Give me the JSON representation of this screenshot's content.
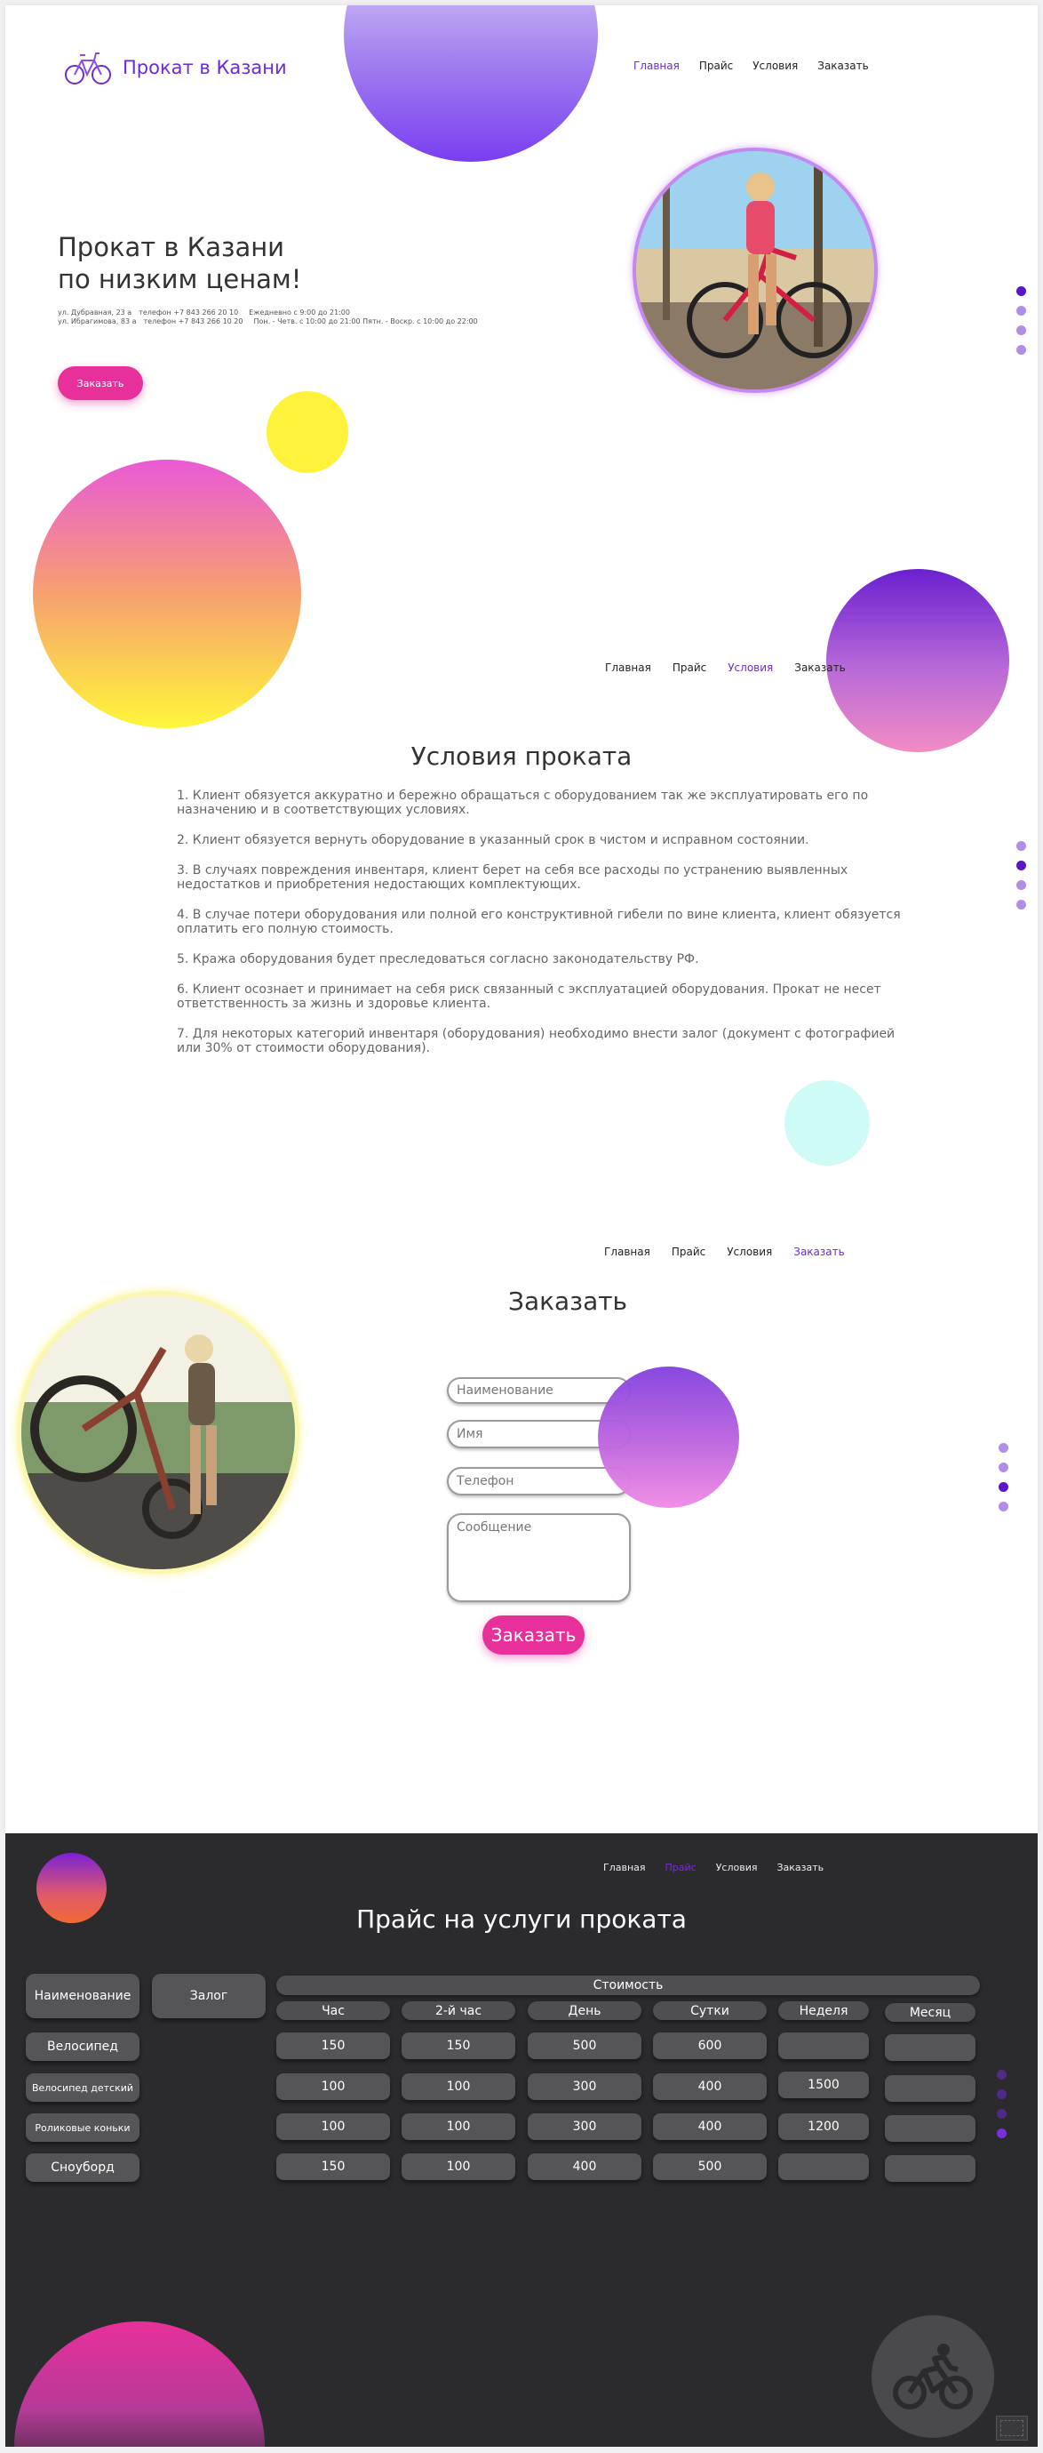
{
  "brand": {
    "name": "Прокат в Казани",
    "logo_icon": "bicycle-icon"
  },
  "nav": [
    "Главная",
    "Прайс",
    "Условия",
    "Заказать"
  ],
  "colors": {
    "accent": "#6b2bd6",
    "pink": "#e8309a",
    "dark_bg": "#2b2a2c"
  },
  "hero": {
    "title_line1": "Прокат в Казани",
    "title_line2": "по низким ценам!",
    "address1": "ул. Дубравная, 23 а",
    "phone1": "телефон +7 843 266 20 10",
    "hours1": "Ежедневно с 9:00 до 21:00",
    "address2": "ул. Ибрагимова, 83 а",
    "phone2": "телефон +7 843 266 10 20",
    "hours2": "Пон. - Четв. с 10:00 до 21:00 Пятн. - Воскр. с 10:00 до 22:00",
    "order_button": "Заказать"
  },
  "conditions": {
    "title": "Условия проката",
    "items": [
      "1. Клиент обязуется аккуратно и бережно обращаться с оборудованием так же эксплуатировать его по назначению и в соответствующих условиях.",
      "2. Клиент обязуется вернуть оборудование в указанный срок в чистом и исправном состоянии.",
      "3. В случаях повреждения инвентаря, клиент берет на себя все расходы по устранению выявленных недостатков и приобретения недостающих комплектующих.",
      "4. В случае потери оборудования или полной его конструктивной гибели по вине клиента, клиент обязуется оплатить его полную стоимость.",
      "5. Кража оборудования будет преследоваться согласно законодательству РФ.",
      "6. Клиент осознает и принимает на себя риск связанный с эксплуатацией оборудования. Прокат не несет ответственность за жизнь и здоровье клиента.",
      "7. Для некоторых категорий инвентаря (оборудования) необходимо внести залог (документ с фотографией или 30% от стоимости оборудования)."
    ]
  },
  "order": {
    "title": "Заказать",
    "select_placeholder": "Наименование",
    "name_placeholder": "Имя",
    "phone_placeholder": "Телефон",
    "message_placeholder": "Сообщение",
    "submit": "Заказать"
  },
  "price": {
    "title": "Прайс на услуги проката",
    "col_name": "Наименование",
    "col_deposit": "Залог",
    "col_cost": "Стоимость",
    "periods": [
      "Час",
      "2-й час",
      "День",
      "Сутки",
      "Неделя",
      "Месяц"
    ],
    "rows": [
      {
        "name": "Велосипед",
        "values": [
          "150",
          "150",
          "500",
          "600",
          "",
          ""
        ]
      },
      {
        "name": "Велосипед детский",
        "values": [
          "100",
          "100",
          "300",
          "400",
          "1500",
          ""
        ]
      },
      {
        "name": "Роликовые коньки",
        "values": [
          "100",
          "100",
          "300",
          "400",
          "1200",
          ""
        ]
      },
      {
        "name": "Сноуборд",
        "values": [
          "150",
          "100",
          "400",
          "500",
          "",
          ""
        ]
      }
    ]
  }
}
